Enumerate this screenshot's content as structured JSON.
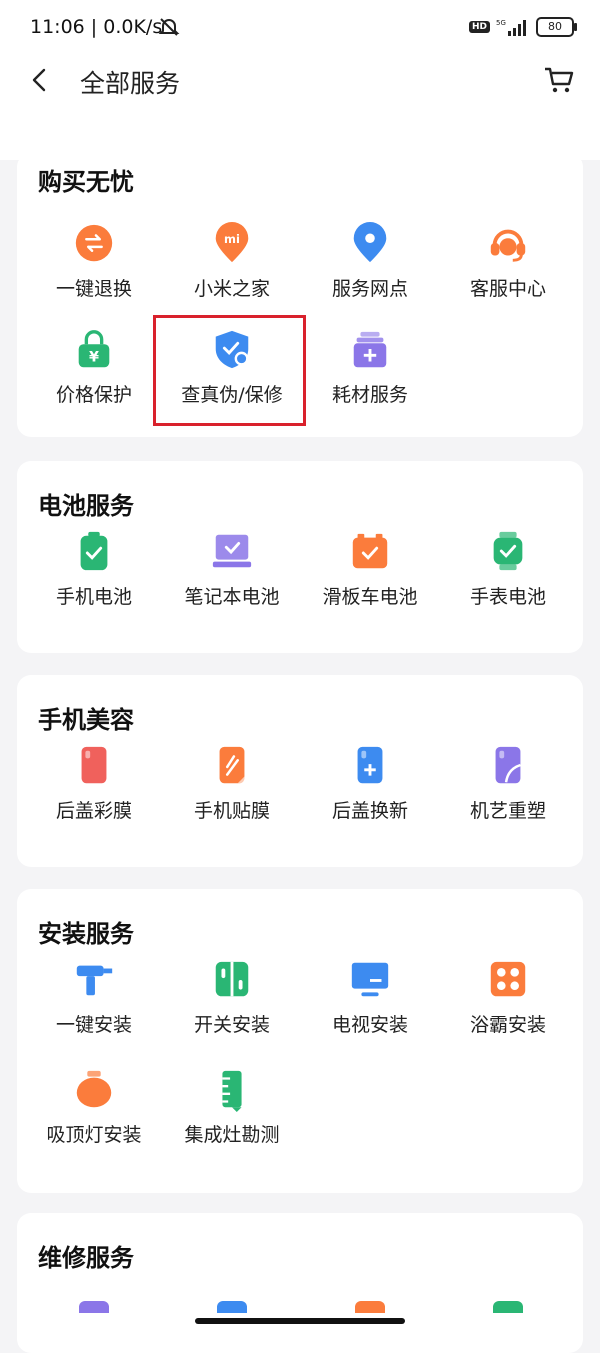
{
  "status": {
    "time": "11:06 | 0.0K/s",
    "network": "5G",
    "battery": "80",
    "hd": "HD"
  },
  "header": {
    "title": "全部服务"
  },
  "sections": [
    {
      "title": "购买无忧",
      "items": [
        {
          "label": "一键退换",
          "icon": "exchange-icon",
          "color": "#fb7c3c"
        },
        {
          "label": "小米之家",
          "icon": "mi-store-pin-icon",
          "color": "#fb7c3c"
        },
        {
          "label": "服务网点",
          "icon": "location-pin-icon",
          "color": "#3d8bf0"
        },
        {
          "label": "客服中心",
          "icon": "headset-icon",
          "color": "#fb7c3c"
        },
        {
          "label": "价格保护",
          "icon": "price-lock-icon",
          "color": "#2ab674"
        },
        {
          "label": "查真伪/保修",
          "icon": "shield-search-icon",
          "color": "#3d8bf0"
        },
        {
          "label": "耗材服务",
          "icon": "supplies-box-icon",
          "color": "#8b76e8"
        }
      ]
    },
    {
      "title": "电池服务",
      "items": [
        {
          "label": "手机电池",
          "icon": "phone-battery-icon",
          "color": "#2ab674"
        },
        {
          "label": "笔记本电池",
          "icon": "laptop-battery-icon",
          "color": "#8b76e8"
        },
        {
          "label": "滑板车电池",
          "icon": "scooter-battery-icon",
          "color": "#fb7c3c"
        },
        {
          "label": "手表电池",
          "icon": "watch-battery-icon",
          "color": "#2ab674"
        }
      ]
    },
    {
      "title": "手机美容",
      "items": [
        {
          "label": "后盖彩膜",
          "icon": "back-cover-film-icon",
          "color": "#f0615c"
        },
        {
          "label": "手机贴膜",
          "icon": "screen-film-icon",
          "color": "#fb7c3c"
        },
        {
          "label": "后盖换新",
          "icon": "back-cover-renew-icon",
          "color": "#3d8bf0"
        },
        {
          "label": "机艺重塑",
          "icon": "reshape-icon",
          "color": "#8b76e8"
        }
      ]
    },
    {
      "title": "安装服务",
      "items": [
        {
          "label": "一键安装",
          "icon": "drill-icon",
          "color": "#3d8bf0"
        },
        {
          "label": "开关安装",
          "icon": "switch-icon",
          "color": "#2ab674"
        },
        {
          "label": "电视安装",
          "icon": "tv-icon",
          "color": "#3d8bf0"
        },
        {
          "label": "浴霸安装",
          "icon": "bath-heater-icon",
          "color": "#fb7c3c"
        },
        {
          "label": "吸顶灯安装",
          "icon": "ceiling-lamp-icon",
          "color": "#fb7c3c"
        },
        {
          "label": "集成灶勘测",
          "icon": "ruler-icon",
          "color": "#2ab674"
        }
      ]
    },
    {
      "title": "维修服务",
      "items": []
    }
  ]
}
